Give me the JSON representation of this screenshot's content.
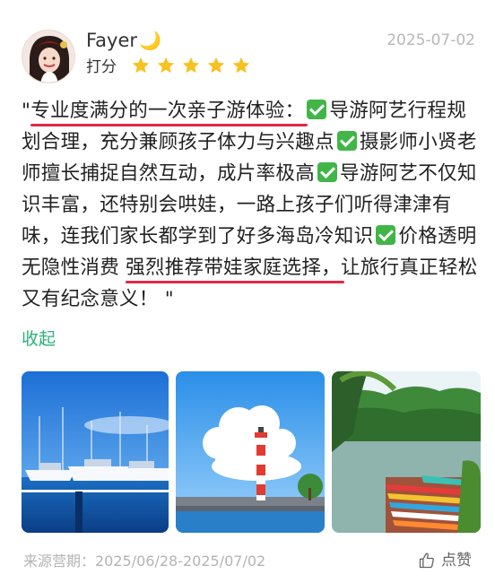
{
  "review": {
    "user": {
      "name": "Fayer",
      "emoji": "🌙"
    },
    "date": "2025-07-02",
    "rating_label": "打分",
    "stars": 5,
    "stars_max": 5,
    "text": {
      "quote_open": "\"",
      "highlight1": "专业度满分的一次亲子游体验：",
      "seg1": "导游阿艺行程规划合理，充分兼顾孩子体力与兴趣点",
      "seg2": "摄影师小贤老师擅长捕捉自然互动，成片率极高",
      "seg3": "导游阿艺不仅知识丰富，还特别会哄娃，一路上孩子们听得津津有味，连我们家长都学到了好多海岛冷知识",
      "seg4a": "价格透明无隐性消费",
      "highlight2": "强烈推荐带娃家庭选择，",
      "tail": "让旅行真正轻松又有纪念意义！",
      "quote_close": " \""
    },
    "collapse_label": "收起",
    "photos": [
      {
        "name": "marina-photo",
        "description": "yachts in marina"
      },
      {
        "name": "lighthouse-photo",
        "description": "red and white lighthouse"
      },
      {
        "name": "lake-boats-photo",
        "description": "colorful boats on lake"
      }
    ],
    "source": "来源营期：2025/06/28-2025/07/02",
    "like_label": "点赞"
  },
  "colors": {
    "accent_green": "#2bb27a",
    "star_yellow": "#f7c11f",
    "underline_red": "#e0294a",
    "check_green": "#41b548"
  },
  "icons": [
    "star-icon",
    "check-mark-icon",
    "thumbs-up-icon",
    "crescent-moon-icon"
  ]
}
